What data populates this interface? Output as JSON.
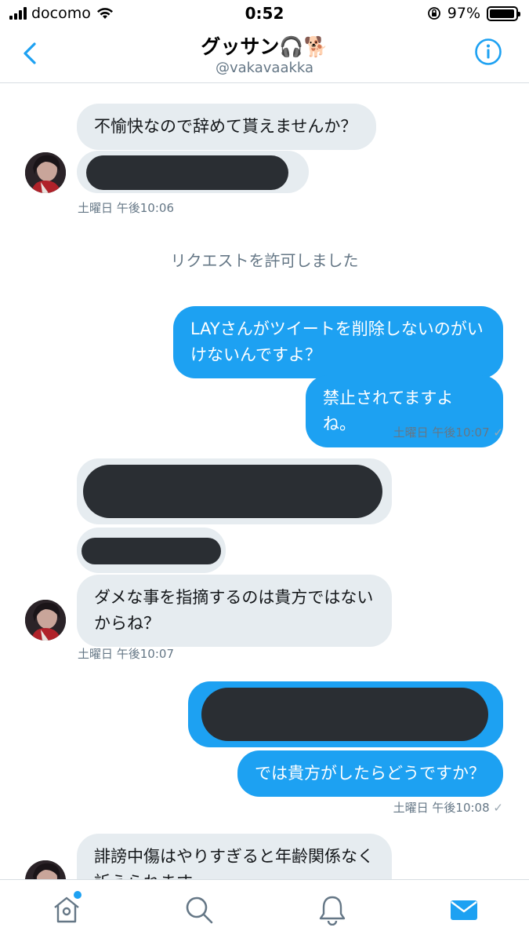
{
  "status": {
    "carrier": "docomo",
    "time": "0:52",
    "battery": "97%",
    "battery_level": 0.97
  },
  "header": {
    "title": "グッサン🎧🐕",
    "handle": "@vakavaakka",
    "back_icon": "chevron-left-icon",
    "info_icon": "info-icon"
  },
  "messages": {
    "m1": "不愉快なので辞めて貰えませんか？",
    "t1": "土曜日 午後10:06",
    "system": "リクエストを許可しました",
    "m2": "LAYさんがツイートを削除しないのがいけないんですよ？",
    "m3": "禁止されてますよね。",
    "t2": "土曜日 午後10:07",
    "m4": "ダメな事を指摘するのは貴方ではないからね？",
    "t3": "土曜日 午後10:07",
    "m5": "では貴方がしたらどうですか？",
    "t4": "土曜日 午後10:08",
    "m6": "誹謗中傷はやりすぎると年齢関係なく訴えられます"
  },
  "tabbar": {
    "items": [
      "home-icon",
      "search-icon",
      "notifications-icon",
      "messages-icon"
    ],
    "active": "messages-icon"
  },
  "colors": {
    "accent": "#1da1f2",
    "incoming": "#e6ecf0",
    "redaction": "#2a2e33",
    "muted": "#657786"
  }
}
